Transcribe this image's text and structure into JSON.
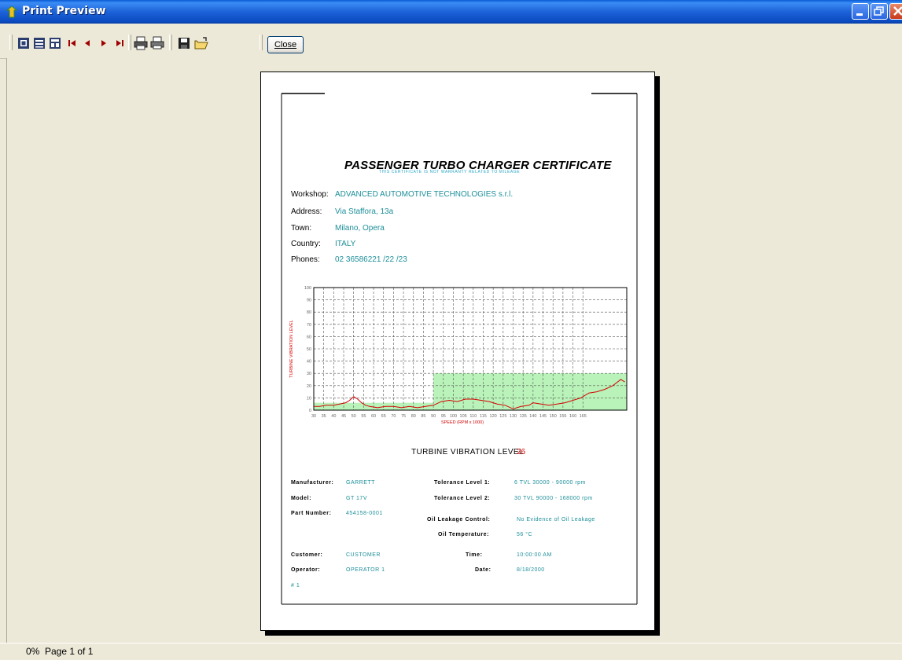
{
  "window": {
    "title": "Print Preview"
  },
  "toolbar": {
    "icons": [
      "one-page-icon",
      "two-pages-icon",
      "multi-page-icon",
      "first-page-icon",
      "previous-page-icon",
      "next-page-icon",
      "last-page-icon",
      "print-setup-icon",
      "print-icon",
      "save-icon",
      "open-icon"
    ],
    "close_label": "Close"
  },
  "certificate": {
    "title": "PASSENGER TURBO CHARGER CERTIFICATE",
    "subtitle": "THIS CERTIFICATE IS NOT WARRANTY RELATED TO MILEAGE",
    "workshop": {
      "label": "Workshop:",
      "value": "ADVANCED AUTOMOTIVE TECHNOLOGIES s.r.l."
    },
    "address": {
      "label": "Address:",
      "value": "Via Staffora, 13a"
    },
    "town": {
      "label": "Town:",
      "value": "Milano, Opera"
    },
    "country": {
      "label": "Country:",
      "value": "ITALY"
    },
    "phones": {
      "label": "Phones:",
      "value": "02 36586221 /22 /23"
    },
    "tvl_label": "TURBINE VIBRATION LEVEL",
    "tvl_value": "26",
    "manufacturer": {
      "label": "Manufacturer:",
      "value": "GARRETT"
    },
    "model": {
      "label": "Model:",
      "value": "GT 17V"
    },
    "part_number": {
      "label": "Part Number:",
      "value": "454158-0001"
    },
    "tolerance1": {
      "label": "Tolerance Level 1:",
      "value": "6 TVL  30000 - 90000 rpm"
    },
    "tolerance2": {
      "label": "Tolerance Level 2:",
      "value": "30 TVL  90000 - 168000 rpm"
    },
    "oil_leakage": {
      "label": "Oil Leakage Control:",
      "value": "No Evidence of Oil Leakage"
    },
    "oil_temperature": {
      "label": "Oil Temperature:",
      "value": "56 °C"
    },
    "customer": {
      "label": "Customer:",
      "value": "CUSTOMER"
    },
    "operator": {
      "label": "Operator:",
      "value": "OPERATOR 1"
    },
    "time": {
      "label": "Time:",
      "value": "10:00:00 AM"
    },
    "date": {
      "label": "Date:",
      "value": "8/18/2000"
    },
    "number": "# 1"
  },
  "status": {
    "zoom": "0%",
    "page": "Page 1 of 1"
  },
  "colors": {
    "titlebar": "#1c62d8",
    "accent_text": "#1d8f9a",
    "series": "#d40000",
    "tolerance_fill": "#b9f3b9"
  },
  "chart_data": {
    "type": "line",
    "xlabel": "SPEED (RPM x 1000)",
    "ylabel": "TURBINE VIBRATION LEVEL",
    "xlim": [
      30,
      187
    ],
    "ylim": [
      0,
      100
    ],
    "x_ticks": [
      30,
      35,
      40,
      45,
      50,
      55,
      60,
      65,
      70,
      75,
      80,
      85,
      90,
      95,
      100,
      105,
      110,
      115,
      120,
      125,
      130,
      135,
      140,
      145,
      150,
      155,
      160,
      165
    ],
    "y_ticks": [
      0,
      10,
      20,
      30,
      40,
      50,
      60,
      70,
      80,
      90,
      100
    ],
    "grid": true,
    "tolerance_bands": [
      {
        "x_from": 30,
        "x_to": 90,
        "y_max": 6
      },
      {
        "x_from": 90,
        "x_to": 187,
        "y_max": 30
      }
    ],
    "series": [
      {
        "x": [
          30,
          33,
          36,
          40,
          43,
          46,
          48,
          50,
          52,
          54,
          56,
          58,
          62,
          66,
          70,
          74,
          78,
          82,
          86,
          90,
          94,
          98,
          102,
          106,
          110,
          114,
          118,
          122,
          126,
          130,
          134,
          138,
          140,
          144,
          148,
          152,
          156,
          160,
          164,
          168,
          172,
          176,
          180,
          184,
          186
        ],
        "y": [
          3,
          3,
          4,
          4,
          5,
          6,
          8,
          11,
          9,
          6,
          4,
          3,
          2,
          3,
          3,
          2,
          3,
          2,
          3,
          4,
          7,
          8,
          7,
          9,
          9,
          8,
          7,
          5,
          4,
          1,
          3,
          4,
          6,
          5,
          4,
          5,
          6,
          8,
          10,
          14,
          15,
          17,
          20,
          25,
          23
        ]
      }
    ]
  }
}
